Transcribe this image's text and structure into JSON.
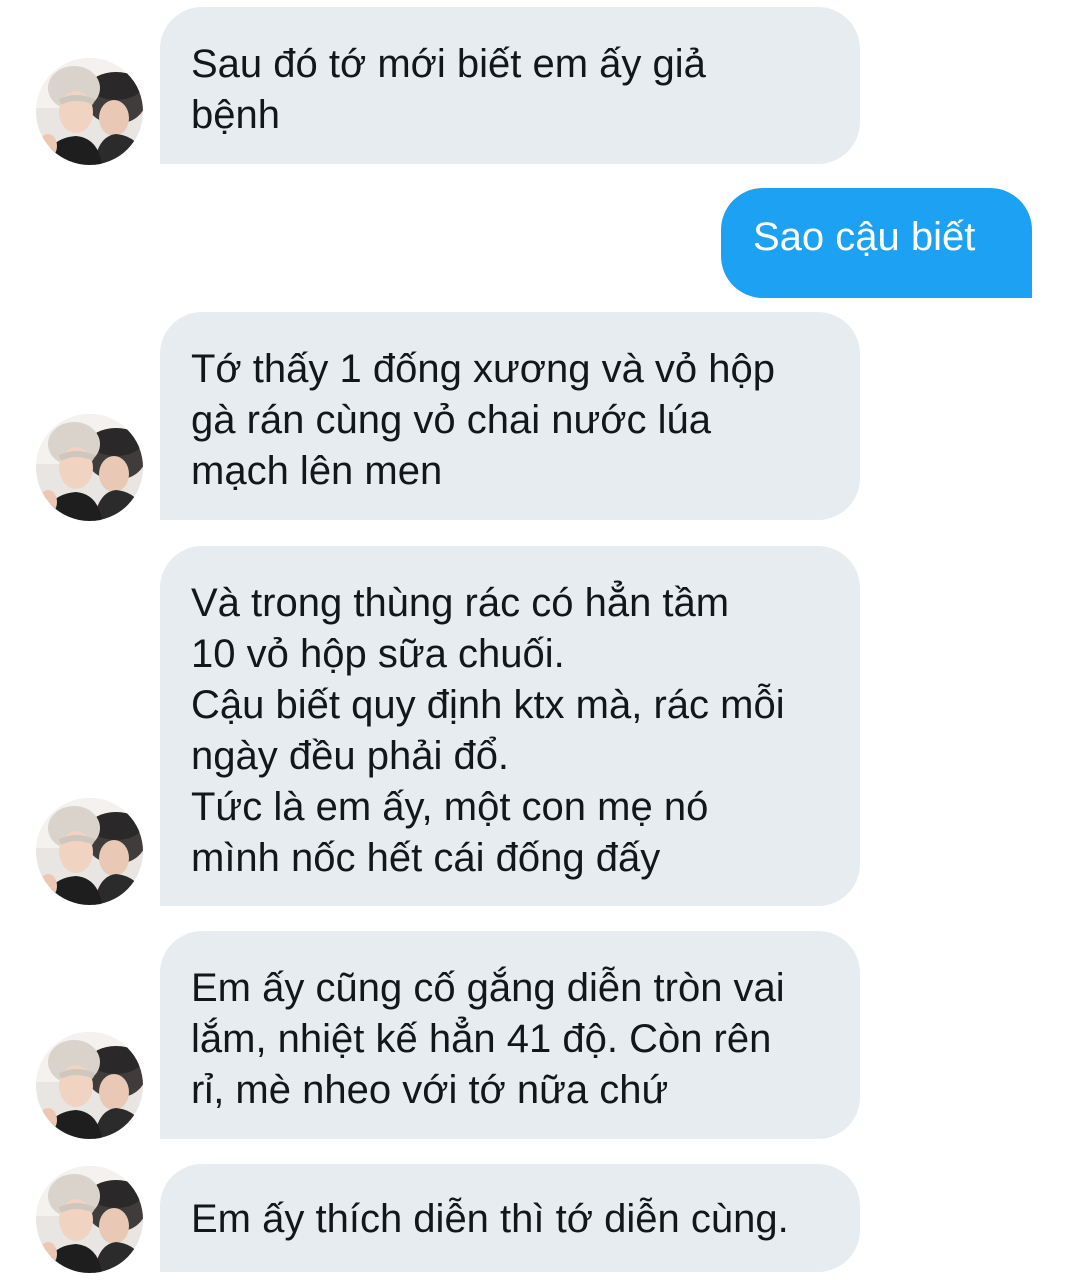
{
  "conversation": {
    "messages": [
      {
        "direction": "incoming",
        "text": "Sau đó tớ mới biết em ấy giả\nbệnh"
      },
      {
        "direction": "outgoing",
        "text": "Sao cậu biết"
      },
      {
        "direction": "incoming",
        "text": "Tớ thấy 1 đống xương và vỏ hộp\ngà rán cùng vỏ chai nước lúa\nmạch lên men"
      },
      {
        "direction": "incoming",
        "text": "Và trong thùng rác có hẳn tầm\n10 vỏ hộp sữa chuối.\nCậu biết quy định ktx mà, rác mỗi\nngày đều phải đổ.\nTức là em ấy, một con mẹ nó\nmình nốc hết cái đống đấy"
      },
      {
        "direction": "incoming",
        "text": "Em ấy cũng cố gắng diễn tròn vai\nlắm, nhiệt kế hẳn 41 độ. Còn rên\nrỉ, mè nheo với tớ nữa chứ"
      },
      {
        "direction": "incoming",
        "text": "Em ấy thích diễn thì tớ diễn cùng."
      }
    ]
  },
  "colors": {
    "incoming_bubble": "#e6ecf0",
    "outgoing_bubble": "#1da1f2",
    "incoming_text": "#14171a",
    "outgoing_text": "#ffffff"
  },
  "icons": {
    "avatar": "contact-avatar-photo"
  }
}
